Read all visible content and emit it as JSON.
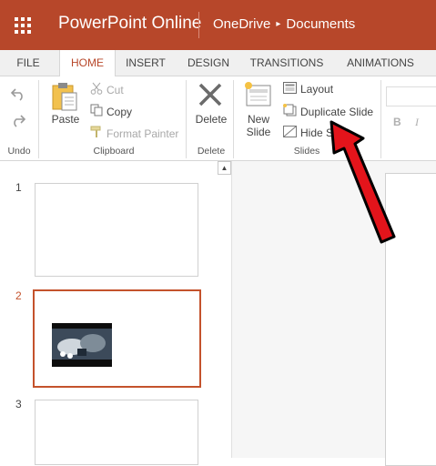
{
  "titlebar": {
    "app_name": "PowerPoint Online",
    "breadcrumb_location": "OneDrive",
    "breadcrumb_separator": "▸",
    "breadcrumb_folder": "Documents",
    "color": "#b7472a"
  },
  "tabs": [
    {
      "label": "FILE",
      "active": false
    },
    {
      "label": "HOME",
      "active": true
    },
    {
      "label": "INSERT",
      "active": false
    },
    {
      "label": "DESIGN",
      "active": false
    },
    {
      "label": "TRANSITIONS",
      "active": false
    },
    {
      "label": "ANIMATIONS",
      "active": false
    }
  ],
  "ribbon": {
    "undo_group": {
      "label": "Undo",
      "undo_icon": "undo-icon",
      "redo_icon": "redo-icon"
    },
    "clipboard": {
      "label": "Clipboard",
      "paste": "Paste",
      "cut": "Cut",
      "copy": "Copy",
      "format_painter": "Format Painter"
    },
    "delete_group": {
      "label": "Delete",
      "delete": "Delete"
    },
    "slides_group": {
      "label": "Slides",
      "new_slide": "New Slide",
      "layout": "Layout",
      "duplicate_slide": "Duplicate Slide",
      "hide_slide": "Hide Slide"
    },
    "font_group": {
      "bold": "B",
      "italic": "I"
    }
  },
  "slides": [
    {
      "number": "1",
      "selected": false,
      "has_image": false
    },
    {
      "number": "2",
      "selected": true,
      "has_image": true
    },
    {
      "number": "3",
      "selected": false,
      "has_image": false
    }
  ],
  "annotation": {
    "type": "red-arrow",
    "color": "#e3141b",
    "points_to": "Duplicate Slide"
  }
}
